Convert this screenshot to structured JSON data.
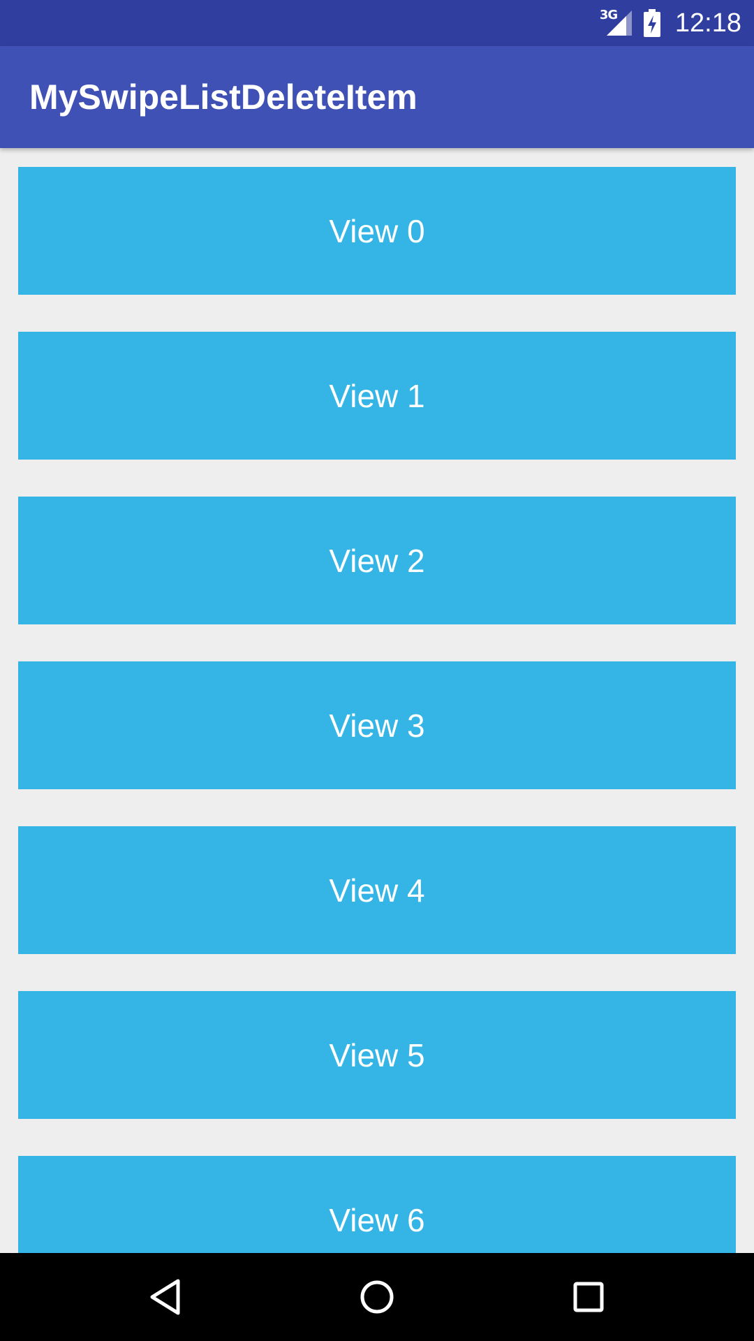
{
  "status_bar": {
    "network_type": "3G",
    "time": "12:18",
    "background_color": "#303f9f",
    "icons": [
      "signal-icon",
      "battery-charging-icon"
    ]
  },
  "app_bar": {
    "title": "MySwipeListDeleteItem",
    "background_color": "#3f51b5"
  },
  "list": {
    "item_color": "#35b5e5",
    "items": [
      {
        "label": "View 0"
      },
      {
        "label": "View 1"
      },
      {
        "label": "View 2"
      },
      {
        "label": "View 3"
      },
      {
        "label": "View 4"
      },
      {
        "label": "View 5"
      },
      {
        "label": "View 6"
      }
    ]
  },
  "nav_bar": {
    "buttons": [
      "back-icon",
      "home-icon",
      "recent-apps-icon"
    ]
  }
}
